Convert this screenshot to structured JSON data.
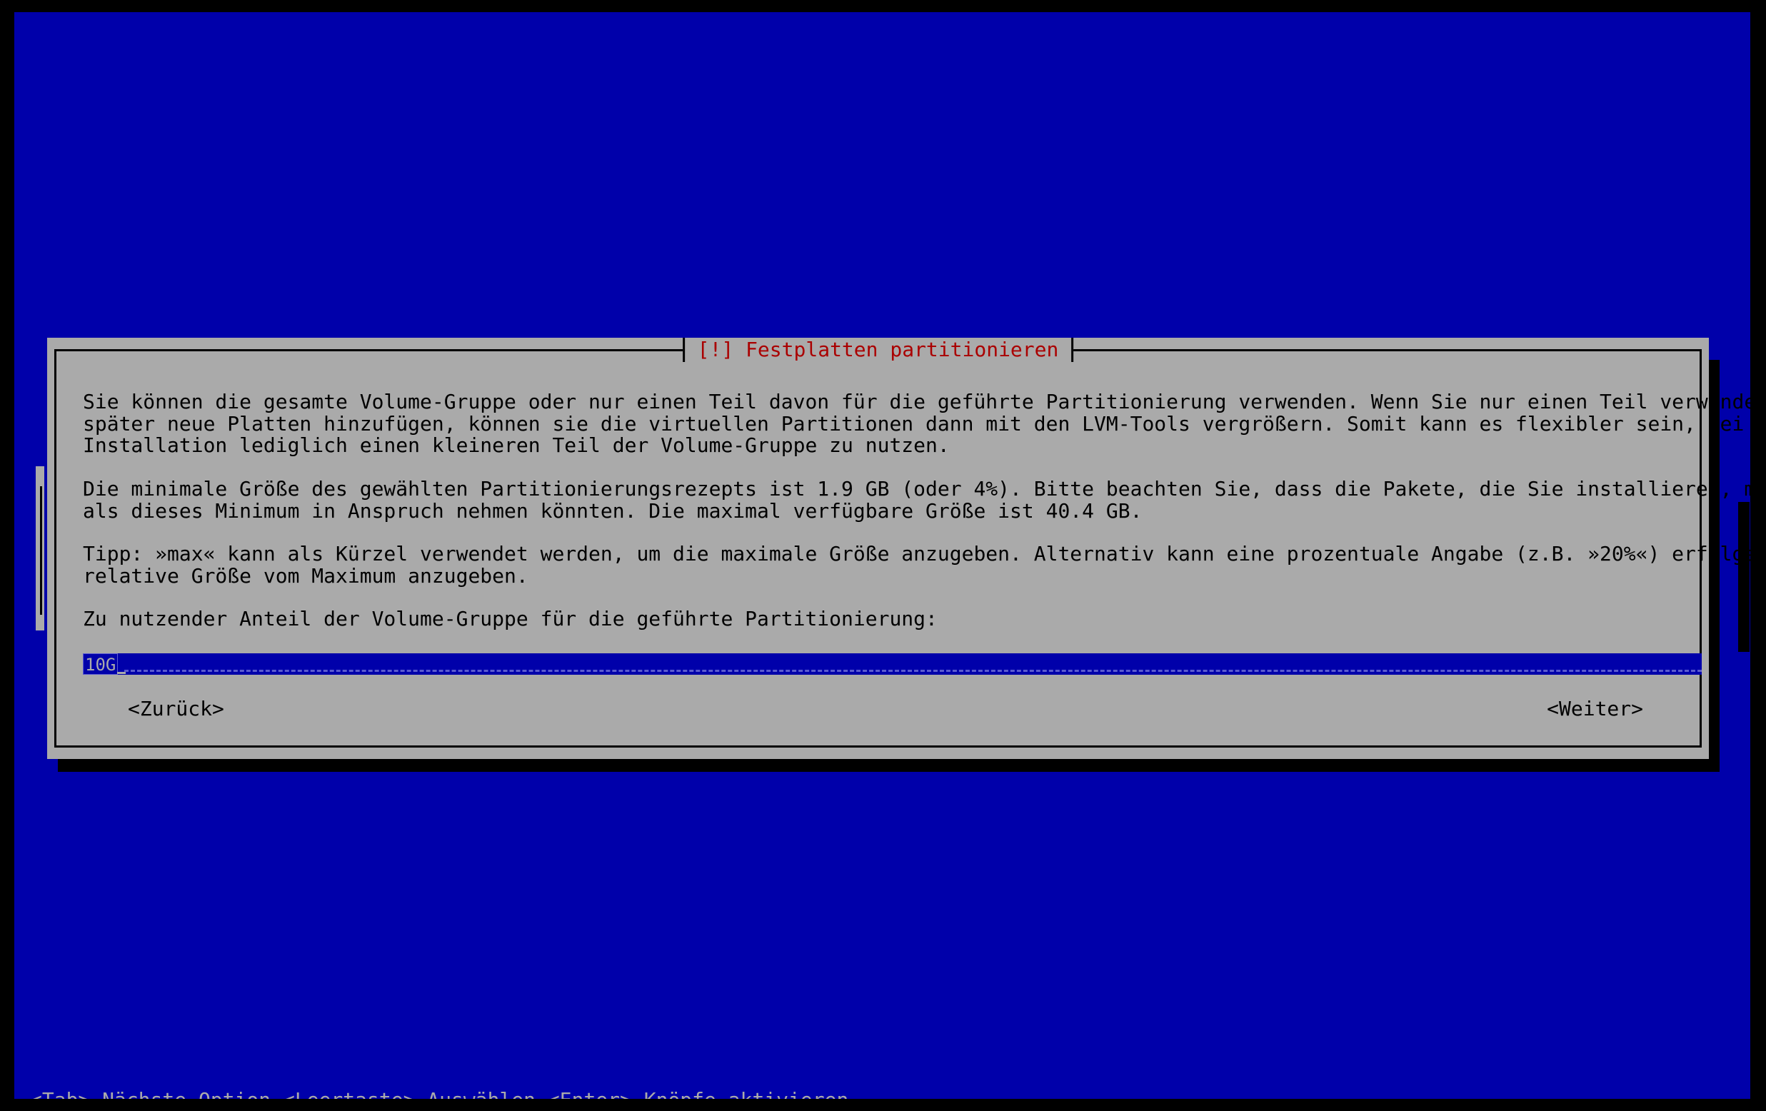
{
  "dialog": {
    "title": "[!] Festplatten partitionieren",
    "paragraphs": [
      "Sie können die gesamte Volume-Gruppe oder nur einen Teil davon für die geführte Partitionierung verwenden. Wenn Sie nur einen Teil verwenden oder\nspäter neue Platten hinzufügen, können sie die virtuellen Partitionen dann mit den LVM-Tools vergrößern. Somit kann es flexibler sein, bei der\nInstallation lediglich einen kleineren Teil der Volume-Gruppe zu nutzen.",
      "Die minimale Größe des gewählten Partitionierungsrezepts ist 1.9 GB (oder 4%). Bitte beachten Sie, dass die Pakete, die Sie installieren, mehr Platz\nals dieses Minimum in Anspruch nehmen könnten. Die maximal verfügbare Größe ist 40.4 GB.",
      "Tipp: »max« kann als Kürzel verwendet werden, um die maximale Größe anzugeben. Alternativ kann eine prozentuale Angabe (z.B. »20%«) erfolgen, um eine\nrelative Größe vom Maximum anzugeben.",
      "Zu nutzender Anteil der Volume-Gruppe für die geführte Partitionierung:"
    ],
    "input_value": "10G",
    "back_button": "<Zurück>",
    "next_button": "<Weiter>"
  },
  "statusbar": {
    "help": "<Tab> Nächste Option <Leertaste> Auswählen <Enter> Knöpfe aktivieren"
  },
  "colors": {
    "background": "#0000aa",
    "dialog": "#aaaaaa",
    "title": "#aa0000",
    "shadow": "#000000"
  }
}
